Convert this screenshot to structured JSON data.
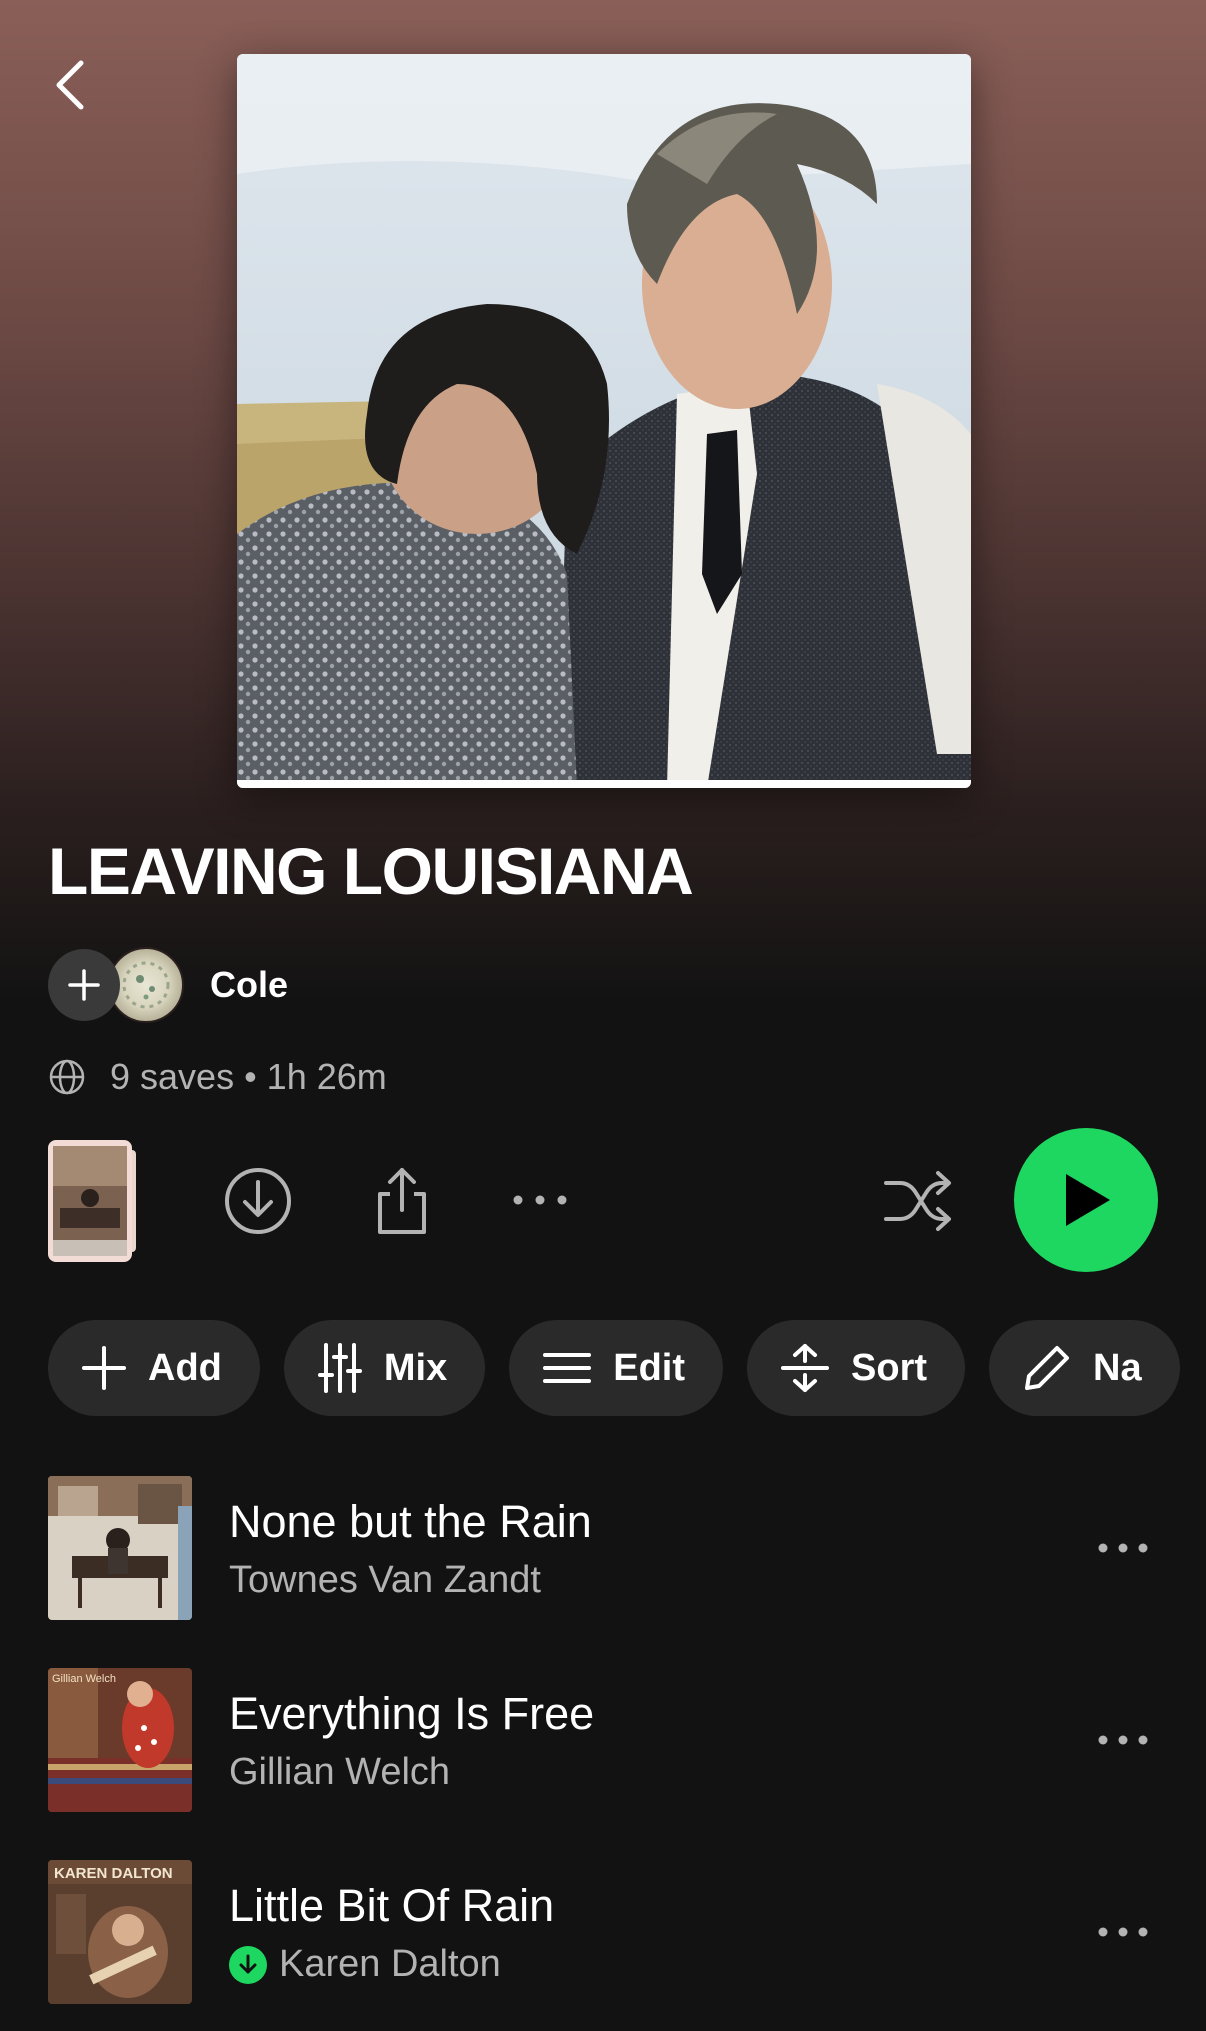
{
  "playlist": {
    "title": "LEAVING LOUISIANA",
    "owner": "Cole",
    "meta": "9 saves • 1h 26m"
  },
  "icons": {
    "back": "chevron-left-icon",
    "add_collaborator": "plus-icon",
    "visibility": "globe-icon",
    "download": "download-icon",
    "share": "share-icon",
    "more": "more-horizontal-icon",
    "shuffle": "shuffle-icon",
    "play": "play-icon"
  },
  "colors": {
    "accent": "#1ed760",
    "background": "#121212",
    "header_gradient_top": "#8a5f58",
    "secondary_text": "#b3b3b3",
    "pill_bg": "#2a2a2a"
  },
  "actions": [
    {
      "label": "Add",
      "icon": "plus-icon"
    },
    {
      "label": "Mix",
      "icon": "sliders-icon"
    },
    {
      "label": "Edit",
      "icon": "list-icon"
    },
    {
      "label": "Sort",
      "icon": "sort-icon"
    },
    {
      "label": "Na",
      "icon": "pencil-icon"
    }
  ],
  "tracks": [
    {
      "title": "None but the Rain",
      "artist": "Townes Van Zandt",
      "downloaded": false
    },
    {
      "title": "Everything Is Free",
      "artist": "Gillian Welch",
      "downloaded": false,
      "art_text": "Gillian Welch"
    },
    {
      "title": "Little Bit Of Rain",
      "artist": "Karen Dalton",
      "downloaded": true,
      "art_text": "KAREN DALTON"
    }
  ]
}
